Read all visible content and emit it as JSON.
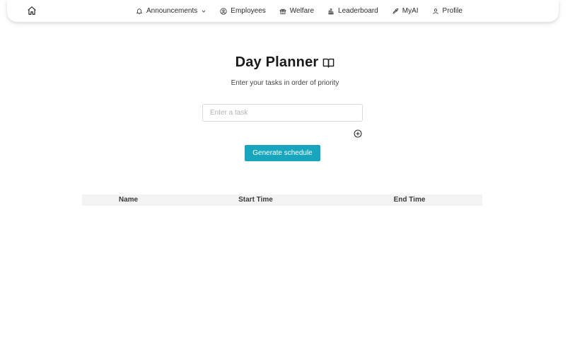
{
  "nav": {
    "home_icon": "home-icon",
    "items": [
      {
        "label": "Announcements",
        "icon": "bell-icon",
        "has_dropdown": true
      },
      {
        "label": "Employees",
        "icon": "user-circle-icon"
      },
      {
        "label": "Welfare",
        "icon": "gift-icon"
      },
      {
        "label": "Leaderboard",
        "icon": "bar-chart-icon"
      },
      {
        "label": "MyAI",
        "icon": "rocket-icon"
      },
      {
        "label": "Profile",
        "icon": "user-icon"
      }
    ]
  },
  "planner": {
    "title": "Day Planner",
    "title_icon": "book-open-icon",
    "subtitle": "Enter your tasks in order of priority",
    "task_placeholder": "Enter a task",
    "task_value": "",
    "add_icon": "plus-circle-icon",
    "generate_label": "Generate schedule"
  },
  "schedule_table": {
    "columns": [
      "Name",
      "Start Time",
      "End Time"
    ],
    "rows": []
  },
  "colors": {
    "accent": "#17a6bd",
    "table_header_bg": "#f3f3f3",
    "text": "#1f1f1f"
  }
}
